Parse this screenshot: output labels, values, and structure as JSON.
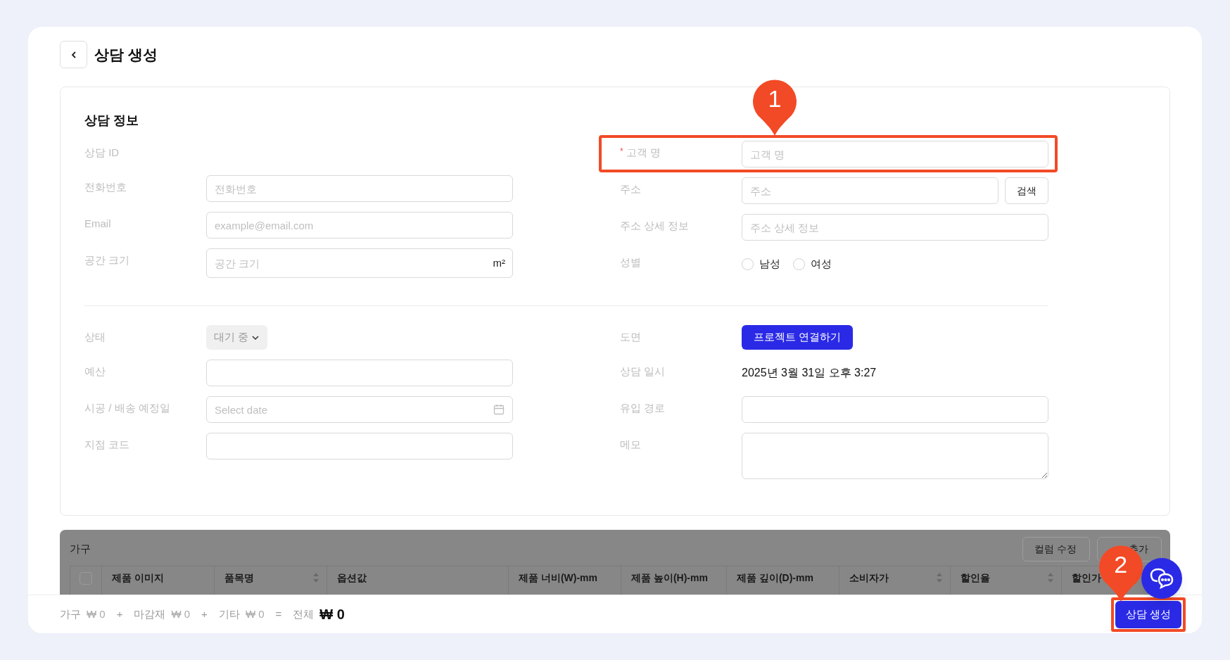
{
  "header": {
    "title": "상담 생성"
  },
  "form": {
    "title": "상담 정보",
    "required_mark": "*",
    "sections": [
      {
        "left": [
          {
            "kind": "empty",
            "label": "상담 ID"
          },
          {
            "kind": "input",
            "label": "전화번호",
            "placeholder": "전화번호"
          },
          {
            "kind": "input",
            "label": "Email",
            "placeholder": "example@email.com"
          },
          {
            "kind": "unit",
            "label": "공간 크기",
            "placeholder": "공간 크기",
            "unit": "m²"
          }
        ],
        "right": [
          {
            "kind": "input",
            "label": "고객 명",
            "required": true,
            "callout": "1",
            "placeholder": "고객 명"
          },
          {
            "kind": "search",
            "label": "주소",
            "placeholder": "주소",
            "button": "검색"
          },
          {
            "kind": "input",
            "label": "주소 상세 정보",
            "placeholder": "주소 상세 정보"
          },
          {
            "kind": "radio",
            "label": "성별",
            "options": [
              {
                "label": "남성",
                "selected": false
              },
              {
                "label": "여성",
                "selected": false
              }
            ]
          }
        ]
      },
      {
        "left": [
          {
            "kind": "select",
            "label": "상태",
            "value": "대기 중"
          },
          {
            "kind": "input",
            "label": "예산"
          },
          {
            "kind": "date",
            "label": "시공 / 배송 예정일",
            "placeholder": "Select date"
          },
          {
            "kind": "input",
            "label": "지점 코드"
          }
        ],
        "right": [
          {
            "kind": "button",
            "label": "도면",
            "button": "프로젝트 연결하기"
          },
          {
            "kind": "text",
            "label": "상담 일시",
            "value": "2025년 3월 31일 오후 3:27"
          },
          {
            "kind": "input",
            "label": "유입 경로"
          },
          {
            "kind": "textarea",
            "label": "메모"
          }
        ]
      }
    ]
  },
  "furniture": {
    "title": "가구",
    "buttons": [
      "컬럼 수정",
      "추가"
    ],
    "select_all": {
      "checked": false
    },
    "columns": [
      {
        "label": "제품 이미지",
        "sortable": false
      },
      {
        "label": "품목명",
        "sortable": true
      },
      {
        "label": "옵션값",
        "sortable": false
      },
      {
        "label": "제품 너비(W)-mm",
        "sortable": false
      },
      {
        "label": "제품 높이(H)-mm",
        "sortable": false
      },
      {
        "label": "제품 깊이(D)-mm",
        "sortable": false
      },
      {
        "label": "소비자가",
        "sortable": true
      },
      {
        "label": "할인율",
        "sortable": true
      },
      {
        "label": "할인가"
      }
    ]
  },
  "footer": {
    "totals": [
      {
        "kind": "term",
        "label": "가구",
        "amount": "₩ 0"
      },
      {
        "kind": "operator",
        "text": "+"
      },
      {
        "kind": "term",
        "label": "마감재",
        "amount": "₩ 0"
      },
      {
        "kind": "operator",
        "text": "+"
      },
      {
        "kind": "term",
        "label": "기타",
        "amount": "₩ 0"
      },
      {
        "kind": "operator",
        "text": "="
      },
      {
        "kind": "total",
        "label": "전체",
        "amount": "₩ 0"
      }
    ],
    "submit": {
      "label": "상담 생성",
      "callout": "2"
    }
  }
}
